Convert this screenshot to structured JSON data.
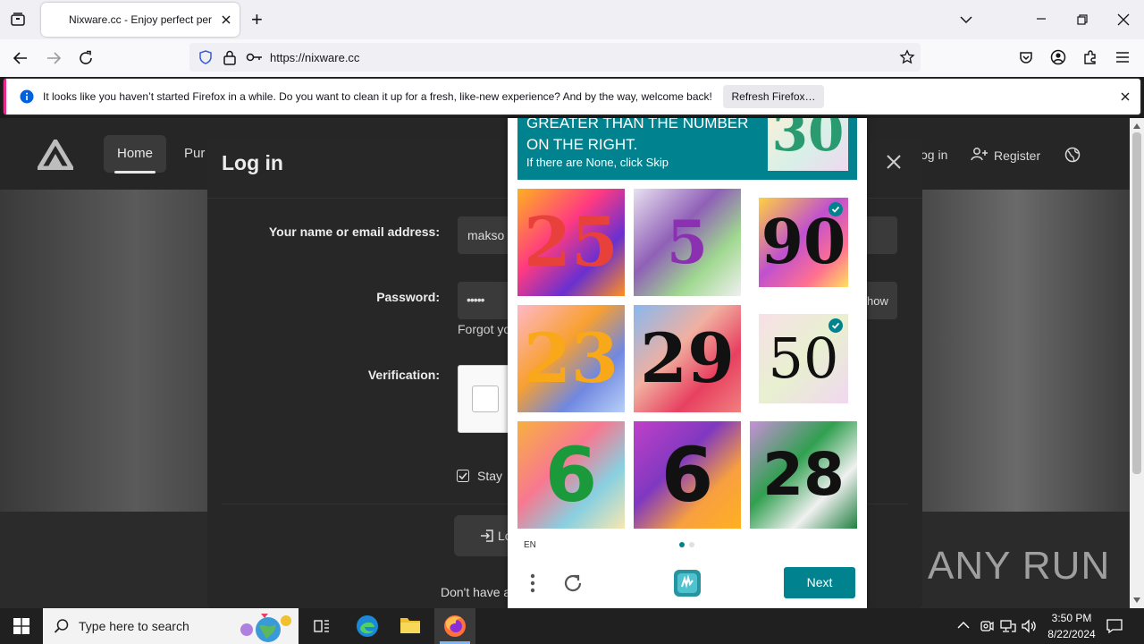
{
  "browser": {
    "tab_title": "Nixware.cc - Enjoy perfect perf...",
    "new_tab": "+",
    "url": "https://nixware.cc"
  },
  "notification": {
    "text": "It looks like you haven’t started Firefox in a while. Do you want to clean it up for a fresh, like-new experience? And by the way, welcome back!",
    "refresh_label": "Refresh Firefox…"
  },
  "site": {
    "nav": {
      "home": "Home",
      "purchase": "Pur",
      "login": "og in",
      "register": "Register"
    }
  },
  "login": {
    "title": "Log in",
    "name_label": "Your name or email address:",
    "name_value": "makso",
    "password_label": "Password:",
    "password_value": "•••••",
    "show": "how",
    "forgot": "Forgot yo",
    "verification_label": "Verification:",
    "stay": "Stay",
    "login_btn": "Lo",
    "no_account": "Don't have a"
  },
  "captcha": {
    "prompt_line1": "GREATER THAN THE NUMBER",
    "prompt_line2": "ON THE RIGHT.",
    "prompt_sub": "If there are None, click Skip",
    "reference_number": "30",
    "tiles": [
      {
        "number": "25",
        "selected": false
      },
      {
        "number": "5",
        "selected": false
      },
      {
        "number": "90",
        "selected": true
      },
      {
        "number": "23",
        "selected": false
      },
      {
        "number": "29",
        "selected": false
      },
      {
        "number": "50",
        "selected": true
      },
      {
        "number": "6",
        "selected": false
      },
      {
        "number": "6",
        "selected": false
      },
      {
        "number": "28",
        "selected": false
      }
    ],
    "language": "EN",
    "next_label": "Next"
  },
  "taskbar": {
    "search_placeholder": "Type here to search",
    "time": "3:50 PM",
    "date": "8/22/2024"
  },
  "watermark": "ANY RUN"
}
